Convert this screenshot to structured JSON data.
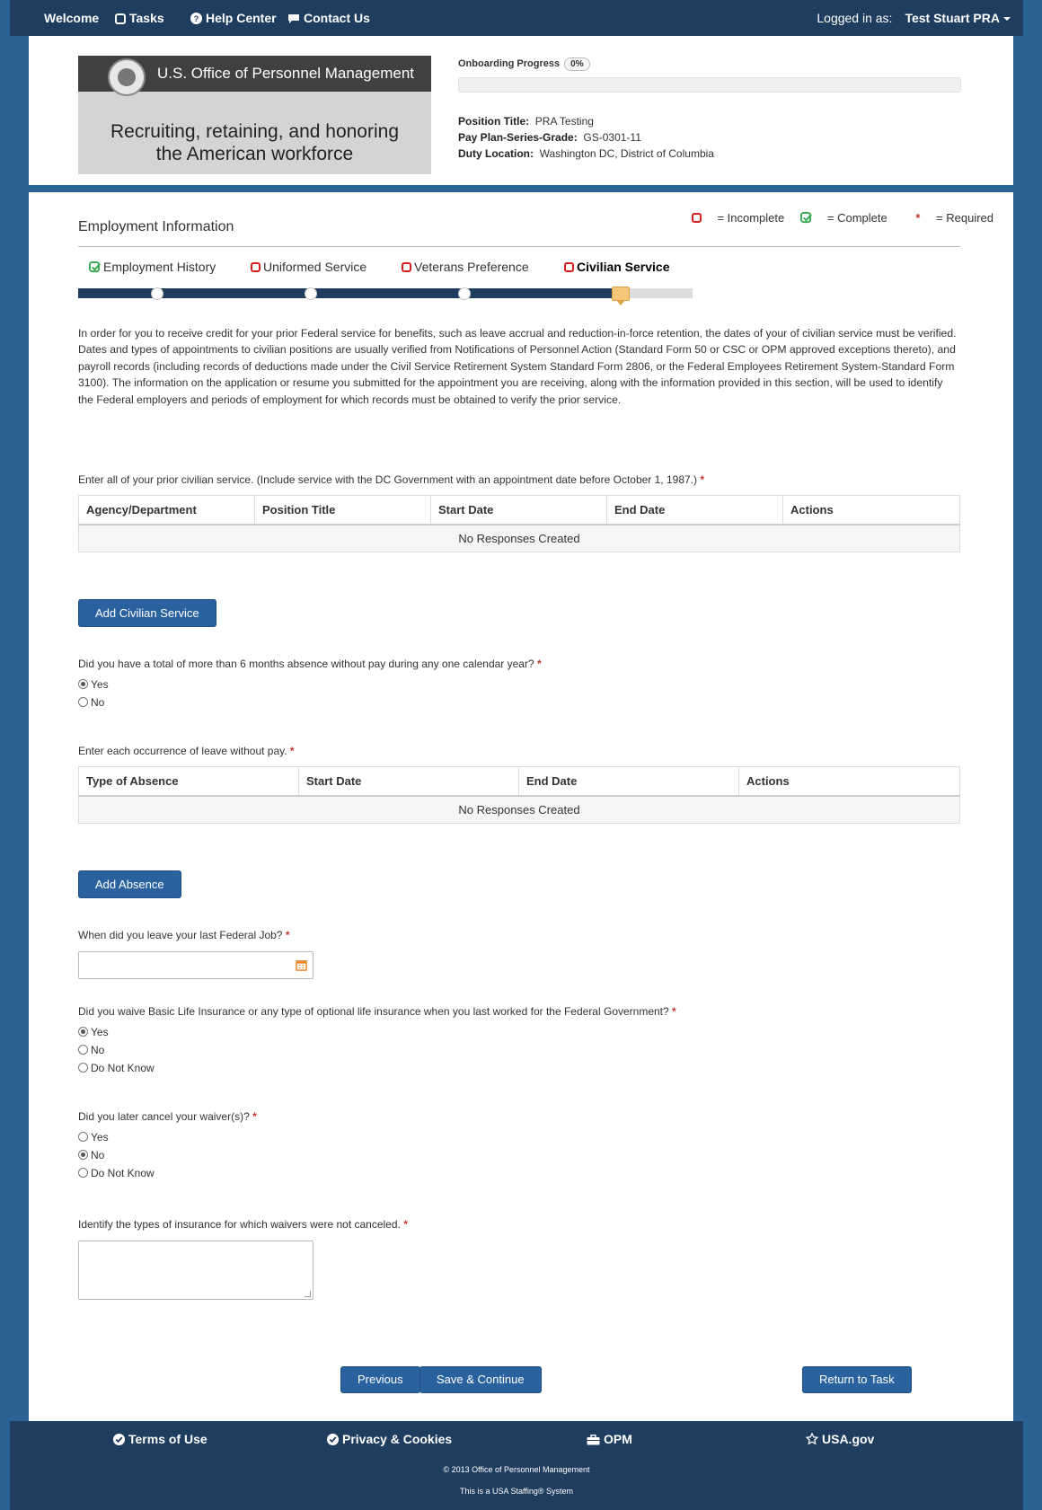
{
  "nav": {
    "welcome": "Welcome",
    "tasks": "Tasks",
    "help_center": "Help Center",
    "contact_us": "Contact Us",
    "logged_in_label": "Logged in as:",
    "user_name": "Test Stuart PRA"
  },
  "header": {
    "logo_agency": "U.S. Office of Personnel Management",
    "logo_tagline_1": "Recruiting, retaining, and honoring",
    "logo_tagline_2": "the American workforce",
    "progress_label": "Onboarding Progress",
    "progress_value": "0%",
    "progress_fraction": 0,
    "position_title_label": "Position Title:",
    "position_title": "PRA Testing",
    "pay_plan_label": "Pay Plan-Series-Grade:",
    "pay_plan": "GS-0301-11",
    "duty_location_label": "Duty Location:",
    "duty_location": "Washington DC, District of Columbia"
  },
  "section": {
    "title": "Employment Information",
    "legend_incomplete": "= Incomplete",
    "legend_complete": "= Complete",
    "legend_required_star": "*",
    "legend_required": "= Required"
  },
  "steps": [
    {
      "label": "Employment History",
      "status": "complete"
    },
    {
      "label": "Uniformed Service",
      "status": "incomplete"
    },
    {
      "label": "Veterans Preference",
      "status": "incomplete"
    },
    {
      "label": "Civilian Service",
      "status": "incomplete",
      "active": true
    }
  ],
  "intro": "In order for you to receive credit for your prior Federal service for benefits, such as leave accrual and reduction-in-force retention, the dates of your of civilian service must be verified. Dates and types of appointments to civilian positions are usually verified from Notifications of Personnel Action (Standard Form 50 or CSC or OPM approved exceptions thereto), and payroll records (including records of deductions made under the Civil Service Retirement System Standard Form 2806, or the Federal Employees Retirement System-Standard Form 3100). The information on the application or resume you submitted for the appointment you are receiving, along with the information provided in this section, will be used to identify the Federal employers and periods of employment for which records must be obtained to verify the prior service.",
  "civilian": {
    "prompt": "Enter all of your prior civilian service. (Include service with the DC Government with an appointment date before October 1, 1987.)",
    "columns": [
      "Agency/Department",
      "Position Title",
      "Start Date",
      "End Date",
      "Actions"
    ],
    "empty": "No Responses Created",
    "add_button": "Add Civilian Service"
  },
  "absence_question": {
    "prompt": "Did you have a total of more than 6 months absence without pay during any one calendar year?",
    "options": [
      "Yes",
      "No"
    ],
    "selected": "Yes"
  },
  "absence": {
    "prompt": "Enter each occurrence of leave without pay.",
    "columns": [
      "Type of Absence",
      "Start Date",
      "End Date",
      "Actions"
    ],
    "empty": "No Responses Created",
    "add_button": "Add Absence"
  },
  "last_job": {
    "prompt": "When did you leave your last Federal Job?",
    "value": ""
  },
  "waive_question": {
    "prompt": "Did you waive Basic Life Insurance or any type of optional life insurance when you last worked for the Federal Government?",
    "options": [
      "Yes",
      "No",
      "Do Not Know"
    ],
    "selected": "Yes"
  },
  "cancel_question": {
    "prompt": "Did you later cancel your waiver(s)?",
    "options": [
      "Yes",
      "No",
      "Do Not Know"
    ],
    "selected": "No"
  },
  "insurance": {
    "prompt": "Identify the types of insurance for which waivers were not canceled.",
    "value": ""
  },
  "required_star": "*",
  "buttons": {
    "previous": "Previous",
    "save_continue": "Save & Continue",
    "return_to_task": "Return to Task"
  },
  "footer": {
    "terms": "Terms of Use",
    "privacy": "Privacy & Cookies",
    "opm": "OPM",
    "usa_gov": "USA.gov",
    "copyright": "© 2013 Office of Personnel Management",
    "staffing": "This is a USA Staffing® System"
  },
  "colors": {
    "nav_bg": "#1f3d5e",
    "page_bg": "#2a6296",
    "button": "#2a62a0",
    "incomplete": "#d62020",
    "complete": "#2ea84a",
    "required": "#c0392b"
  }
}
